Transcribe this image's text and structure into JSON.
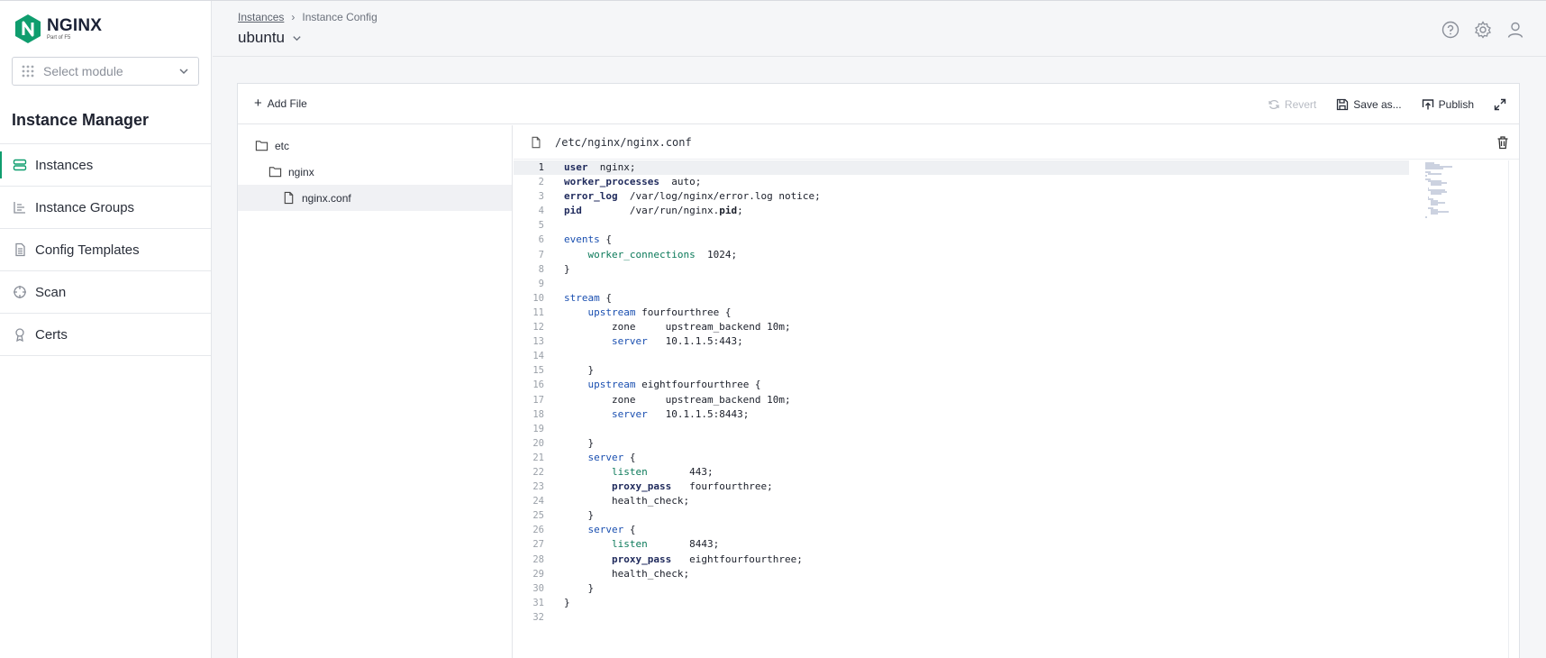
{
  "brand": {
    "name": "NGINX",
    "sub": "Part of F5"
  },
  "module_select": {
    "placeholder": "Select module"
  },
  "sidebar": {
    "title": "Instance Manager",
    "items": [
      {
        "label": "Instances",
        "icon": "server-icon",
        "active": true
      },
      {
        "label": "Instance Groups",
        "icon": "group-icon",
        "active": false
      },
      {
        "label": "Config Templates",
        "icon": "document-icon",
        "active": false
      },
      {
        "label": "Scan",
        "icon": "crosshair-icon",
        "active": false
      },
      {
        "label": "Certs",
        "icon": "certificate-icon",
        "active": false
      }
    ]
  },
  "header": {
    "breadcrumb": {
      "link": "Instances",
      "current": "Instance Config"
    },
    "title": "ubuntu",
    "icons": [
      "help-icon",
      "settings-icon",
      "user-icon"
    ]
  },
  "toolbar": {
    "add_file": "Add File",
    "revert": "Revert",
    "save_as": "Save as...",
    "publish": "Publish"
  },
  "tree": {
    "items": [
      {
        "label": "etc",
        "type": "folder",
        "depth": 0
      },
      {
        "label": "nginx",
        "type": "folder",
        "depth": 1
      },
      {
        "label": "nginx.conf",
        "type": "file",
        "depth": 2,
        "selected": true
      }
    ]
  },
  "editor": {
    "path": "/etc/nginx/nginx.conf",
    "current_line": 1,
    "lines": [
      "user  nginx;",
      "worker_processes  auto;",
      "error_log  /var/log/nginx/error.log notice;",
      "pid        /var/run/nginx.pid;",
      "",
      "events {",
      "    worker_connections  1024;",
      "}",
      "",
      "stream {",
      "    upstream fourfourthree {",
      "        zone     upstream_backend 10m;",
      "        server   10.1.1.5:443;",
      "",
      "    }",
      "    upstream eightfourfourthree {",
      "        zone     upstream_backend 10m;",
      "        server   10.1.1.5:8443;",
      "",
      "    }",
      "    server {",
      "        listen       443;",
      "        proxy_pass   fourfourthree;",
      "        health_check;",
      "    }",
      "    server {",
      "        listen       8443;",
      "        proxy_pass   eightfourfourthree;",
      "        health_check;",
      "    }",
      "}",
      ""
    ]
  },
  "colors": {
    "accent": "#0f9d6e",
    "keyword_blue": "#1a4fb0",
    "keyword_green": "#0c7a5a"
  }
}
